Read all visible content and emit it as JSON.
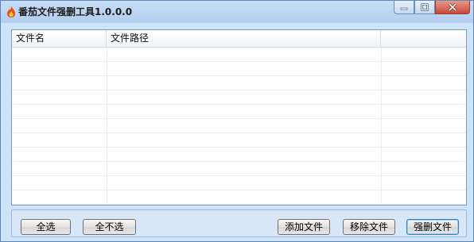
{
  "window": {
    "title": "番茄文件强删工具1.0.0.0",
    "controls": [
      "minimize-icon",
      "maximize-icon",
      "close-icon"
    ]
  },
  "list": {
    "columns": [
      "文件名",
      "文件路径",
      ""
    ],
    "rows": []
  },
  "buttons": {
    "select_all": "全选",
    "select_none": "全不选",
    "add_file": "添加文件",
    "remove_file": "移除文件",
    "force_delete": "强删文件"
  },
  "colors": {
    "window_bg": "#cfe3f8",
    "close_button": "#c8483a",
    "selection_accent": "#4a78b8"
  }
}
